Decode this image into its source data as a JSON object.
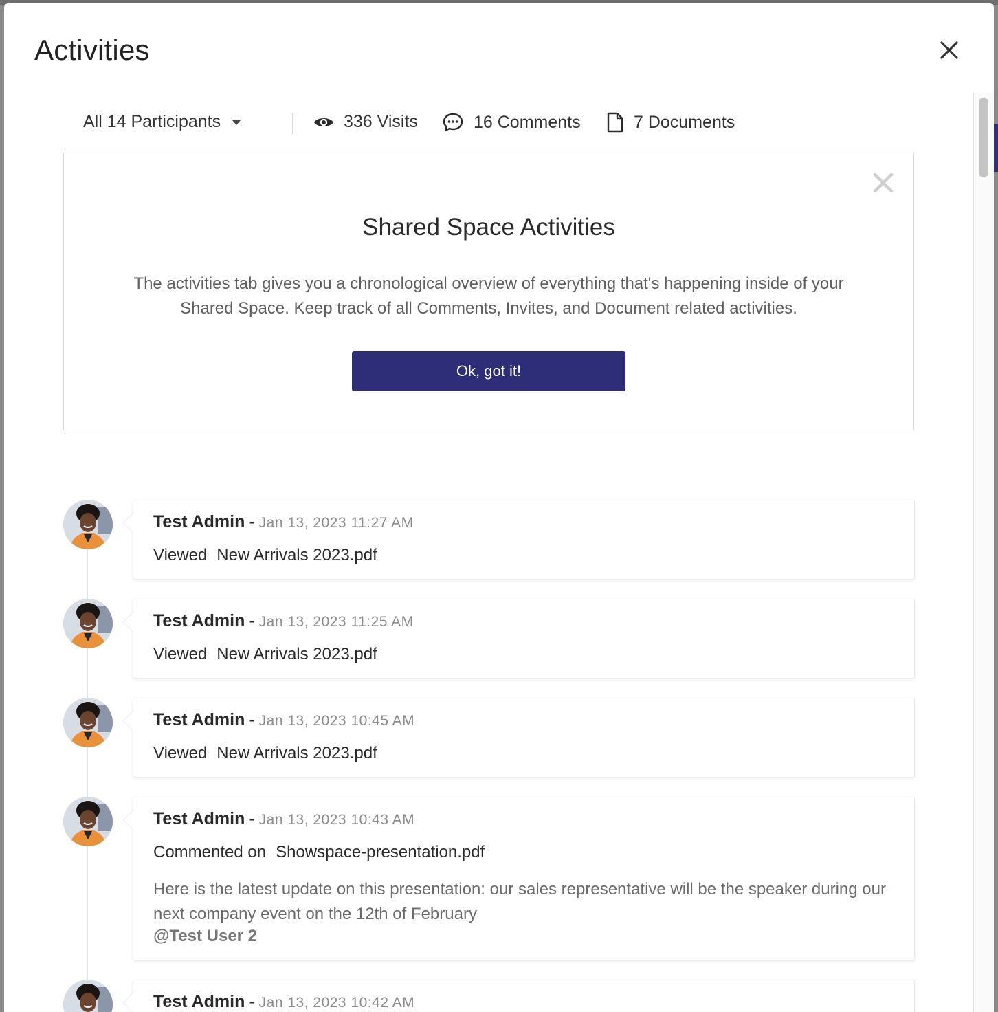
{
  "modal": {
    "title": "Activities"
  },
  "stats": {
    "participants_label": "All 14 Participants",
    "visits": "336 Visits",
    "comments": "16 Comments",
    "documents": "7 Documents"
  },
  "info_box": {
    "title": "Shared Space Activities",
    "text": "The activities tab gives you a chronological overview of everything that's happening inside of your Shared Space. Keep track of all Comments, Invites, and Document related activities.",
    "button_label": "Ok, got it!"
  },
  "activities": [
    {
      "author": "Test Admin",
      "sep": "-",
      "timestamp": "Jan 13, 2023 11:27 AM",
      "verb": "Viewed",
      "target": "New Arrivals 2023.pdf"
    },
    {
      "author": "Test Admin",
      "sep": "-",
      "timestamp": "Jan 13, 2023 11:25 AM",
      "verb": "Viewed",
      "target": "New Arrivals 2023.pdf"
    },
    {
      "author": "Test Admin",
      "sep": "-",
      "timestamp": "Jan 13, 2023 10:45 AM",
      "verb": "Viewed",
      "target": "New Arrivals 2023.pdf"
    },
    {
      "author": "Test Admin",
      "sep": "-",
      "timestamp": "Jan 13, 2023 10:43 AM",
      "verb": "Commented on",
      "target": "Showspace-presentation.pdf",
      "comment": "Here is the latest update on this presentation: our sales representative will be the speaker during our next company event on the 12th of February",
      "mention": "@Test User 2"
    },
    {
      "author": "Test Admin",
      "sep": "-",
      "timestamp": "Jan 13, 2023 10:42 AM"
    }
  ],
  "colors": {
    "primary_button": "#2e2e78",
    "timestamp": "#8b8b8b"
  },
  "icons": {
    "close": "close-icon",
    "visits": "eye-icon",
    "comments": "speech-bubble-icon",
    "documents": "document-icon",
    "dropdown": "caret-down-icon"
  }
}
